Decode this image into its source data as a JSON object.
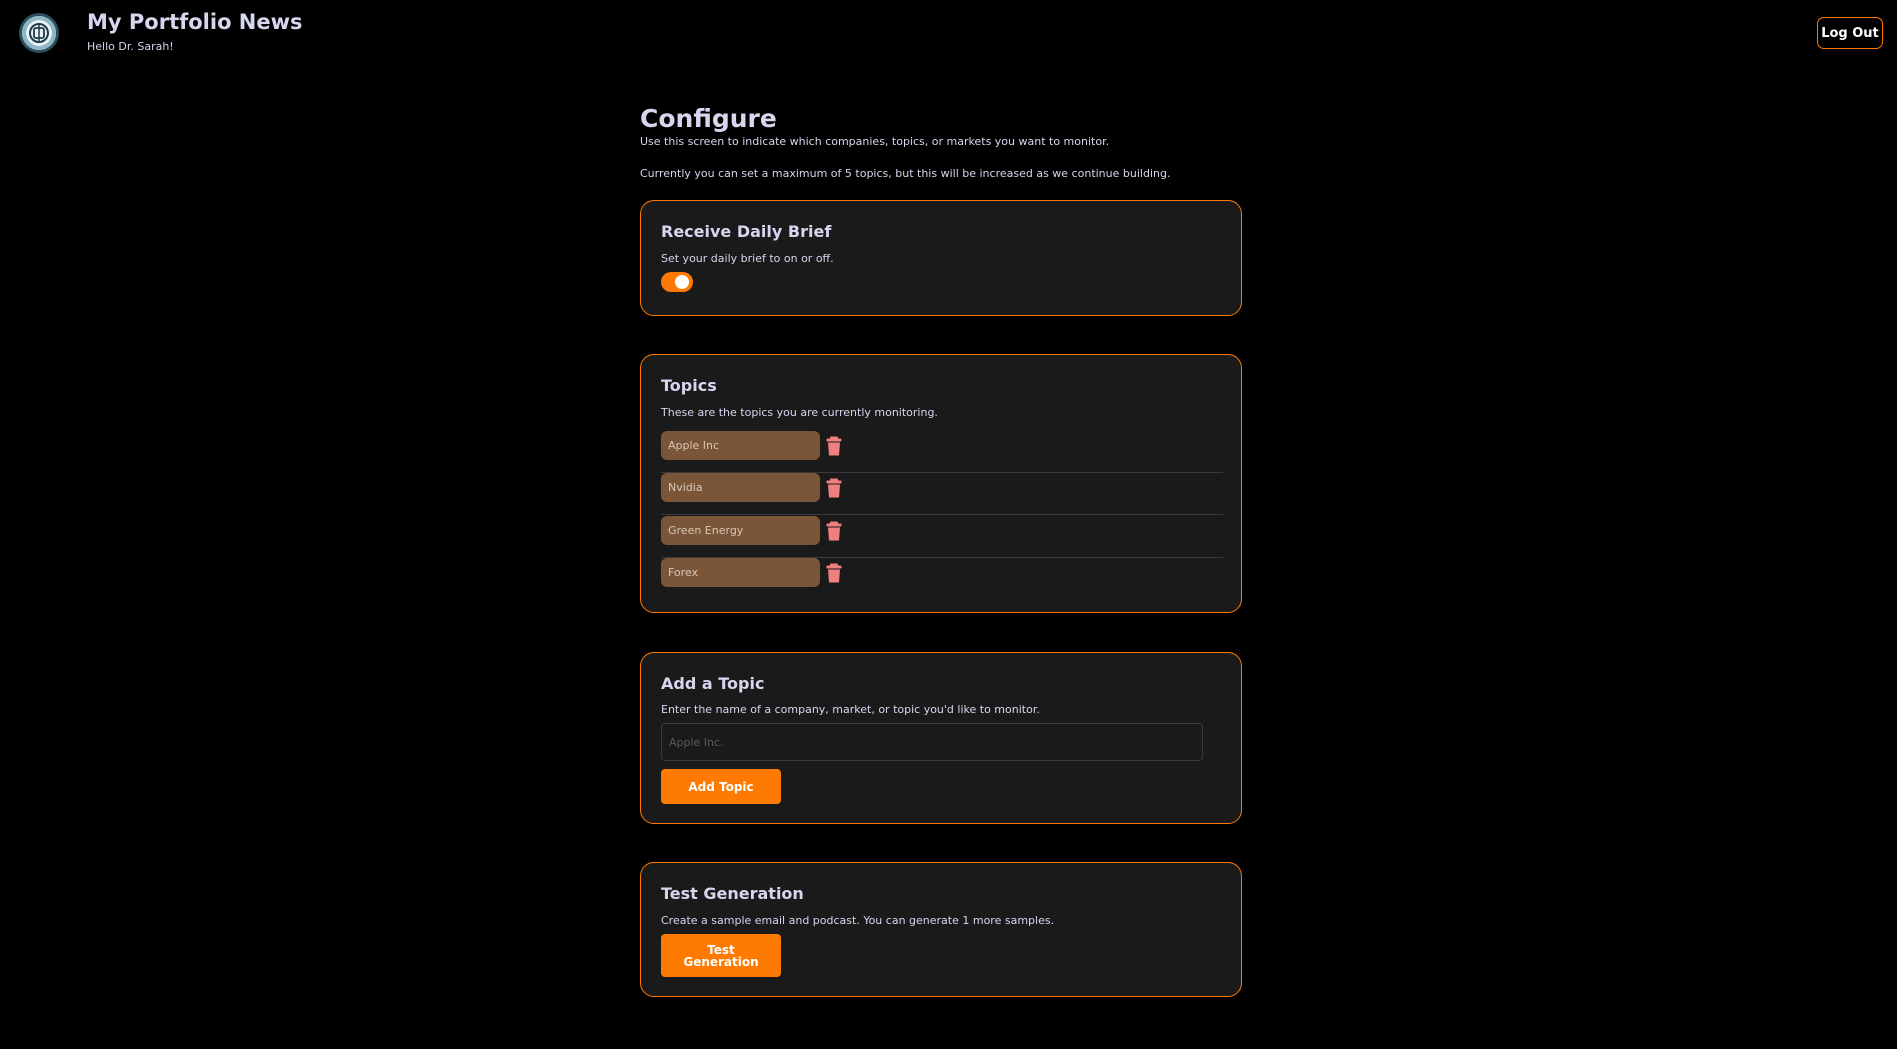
{
  "header": {
    "app_title": "My Portfolio News",
    "greeting": "Hello Dr. Sarah!",
    "logout_label": "Log Out"
  },
  "configure": {
    "title": "Configure",
    "intro_line1": "Use this screen to indicate which companies, topics, or markets you want to monitor.",
    "intro_line2": "Currently you can set a maximum of 5 topics, but this will be increased as we continue building."
  },
  "daily_brief": {
    "title": "Receive Daily Brief",
    "description": "Set your daily brief to on or off.",
    "enabled": true
  },
  "topics": {
    "title": "Topics",
    "description": "These are the topics you are currently monitoring.",
    "items": [
      {
        "label": "Apple Inc"
      },
      {
        "label": "Nvidia"
      },
      {
        "label": "Green Energy"
      },
      {
        "label": "Forex"
      }
    ]
  },
  "add_topic": {
    "title": "Add a Topic",
    "description": "Enter the name of a company, market, or topic you'd like to monitor.",
    "input_value": "",
    "input_placeholder": "Apple Inc.",
    "button_label": "Add Topic"
  },
  "test_generation": {
    "title": "Test Generation",
    "description": "Create a sample email and podcast.  You can generate 1 more samples.",
    "button_label": "Test Generation"
  },
  "colors": {
    "background": "#000000",
    "card": "#1a1a1b",
    "accent": "#ff7a00",
    "chip": "#7a5538",
    "delete": "#f08080",
    "text": "#d6d6ef"
  },
  "icons": {
    "logo": "brand-logo-icon",
    "delete": "trash-icon",
    "toggle": "toggle-switch"
  }
}
